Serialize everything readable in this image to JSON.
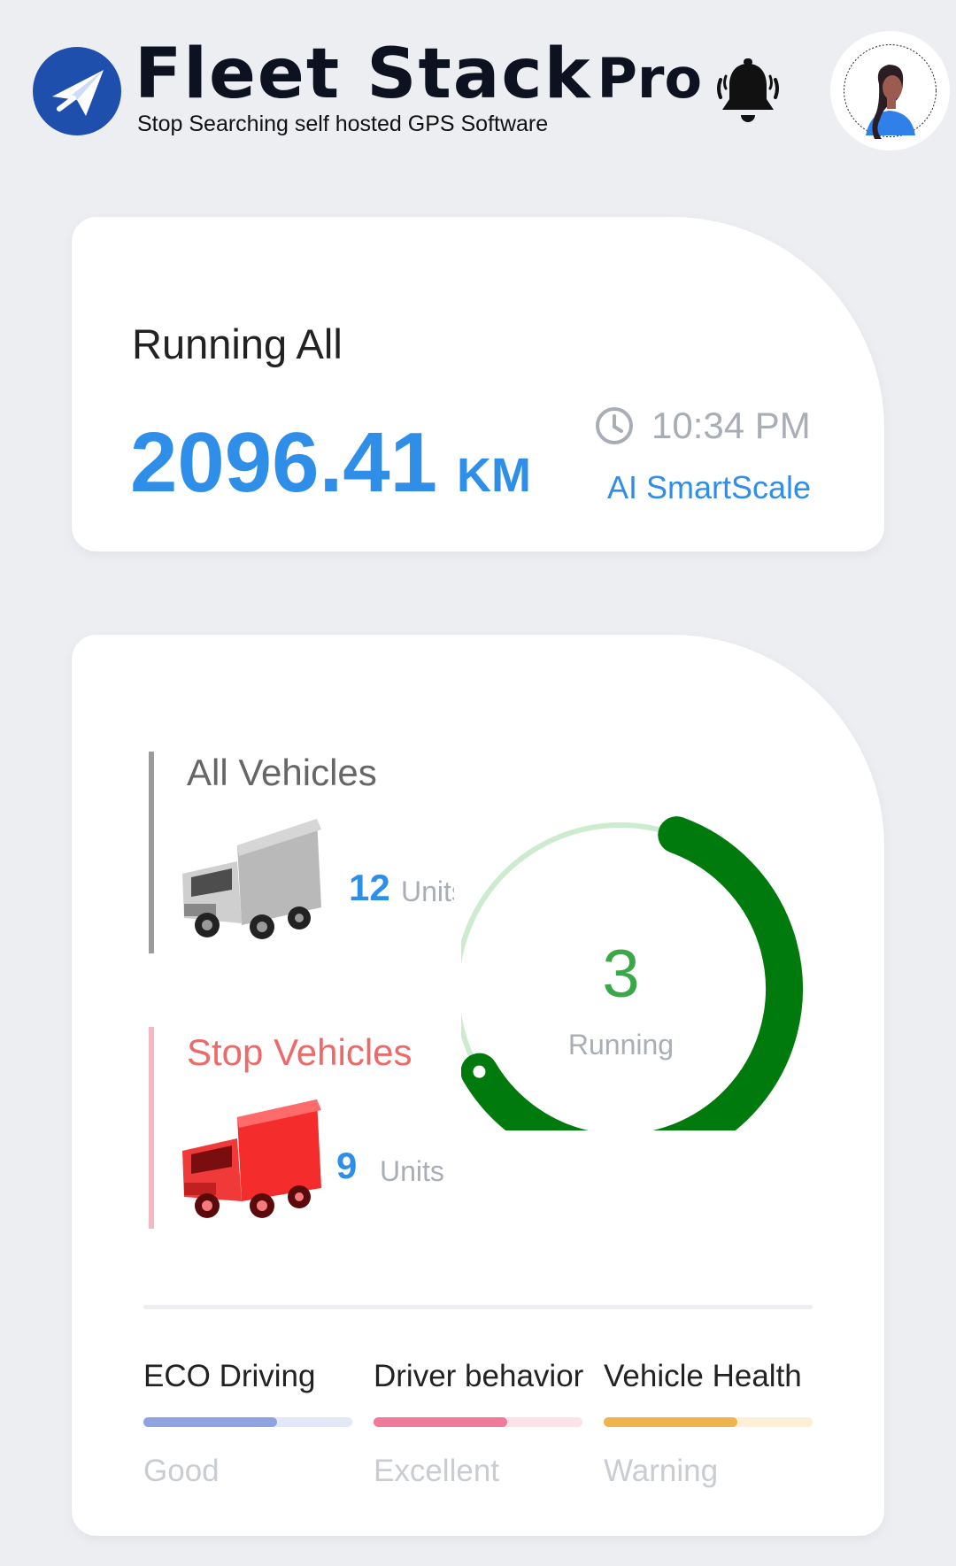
{
  "header": {
    "logo_icon": "paper-plane-icon",
    "brand_name": "Fleet Stack",
    "brand_suffix": "Pro",
    "tagline": "Stop Searching self hosted GPS Software",
    "notification_icon": "bell-icon",
    "avatar_icon": "user-avatar-icon"
  },
  "summary": {
    "title": "Running All",
    "distance_value": "2096.41",
    "distance_unit": "KM",
    "time": "10:34 PM",
    "time_icon": "clock-icon",
    "scale_label": "AI SmartScale"
  },
  "vehicles": {
    "all": {
      "title": "All Vehicles",
      "count": "12",
      "units": "Units",
      "icon": "gray-truck-icon"
    },
    "stopped": {
      "title": "Stop Vehicles",
      "count": "9",
      "units": "Units",
      "icon": "red-truck-icon"
    },
    "running": {
      "count": "3",
      "label": "Running",
      "progress_fraction": 0.61
    }
  },
  "metrics": [
    {
      "title": "ECO Driving",
      "status": "Good",
      "progress": 0.64,
      "color": "#8fa3e0",
      "track_color": "#e3e8f8"
    },
    {
      "title": "Driver behavior",
      "status": "Excellent",
      "progress": 0.64,
      "color": "#ef7a9a",
      "track_color": "#fbe1e8"
    },
    {
      "title": "Vehicle Health",
      "status": "Warning",
      "progress": 0.64,
      "color": "#f0b44c",
      "track_color": "#fcefd6"
    }
  ],
  "colors": {
    "accent_blue": "#2f8fe8",
    "running_green": "#007a0c",
    "running_track": "#cdebcf",
    "stop_red": "#ec6a6a"
  }
}
